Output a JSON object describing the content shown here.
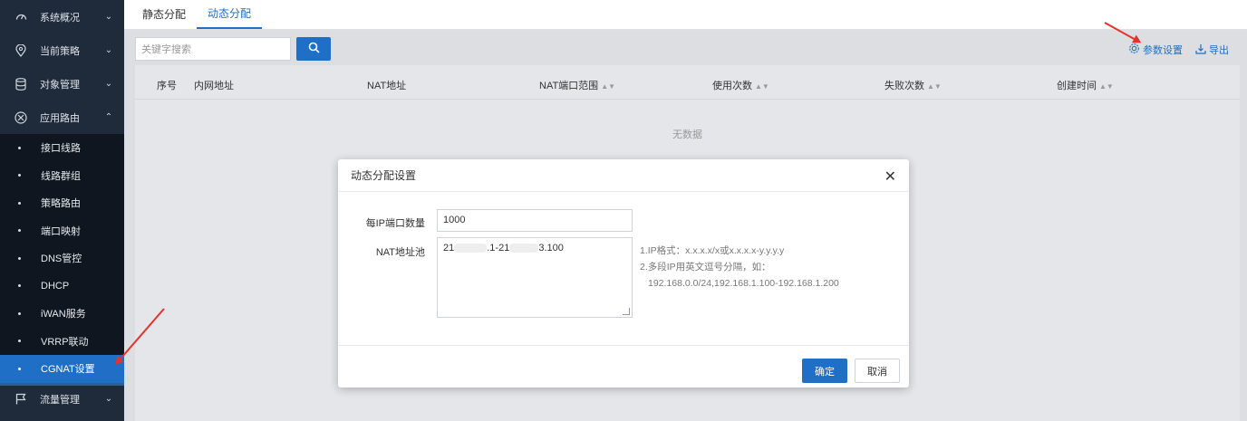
{
  "sidebar": {
    "groups_top": [
      {
        "label": "系统概况",
        "icon": "gauge-icon"
      },
      {
        "label": "当前策略",
        "icon": "location-pin-icon"
      },
      {
        "label": "对象管理",
        "icon": "database-icon"
      },
      {
        "label": "应用路由",
        "icon": "route-icon"
      }
    ],
    "sub_items": [
      {
        "label": "接口线路"
      },
      {
        "label": "线路群组"
      },
      {
        "label": "策略路由"
      },
      {
        "label": "端口映射"
      },
      {
        "label": "DNS管控"
      },
      {
        "label": "DHCP"
      },
      {
        "label": "iWAN服务"
      },
      {
        "label": "VRRP联动"
      },
      {
        "label": "CGNAT设置",
        "active": true
      }
    ],
    "groups_bottom": [
      {
        "label": "流量管理",
        "icon": "flag-icon"
      }
    ]
  },
  "tabs": [
    {
      "label": "静态分配"
    },
    {
      "label": "动态分配",
      "active": true
    }
  ],
  "toolbar": {
    "search_placeholder": "关键字搜索",
    "params_label": "参数设置",
    "export_label": "导出"
  },
  "table": {
    "columns": [
      "序号",
      "内网地址",
      "NAT地址",
      "NAT端口范围",
      "使用次数",
      "失败次数",
      "创建时间"
    ],
    "empty_text": "无数据"
  },
  "modal": {
    "title": "动态分配设置",
    "port_count_label": "每IP端口数量",
    "port_count_value": "1000",
    "pool_label": "NAT地址池",
    "pool_value_start": "21",
    "pool_value_mid": ".1-21",
    "pool_value_end": "3.100",
    "hint_line1": "1.IP格式：x.x.x.x/x或x.x.x.x-y.y.y.y",
    "hint_line2": "2.多段IP用英文逗号分隔，如：",
    "hint_line3": "192.168.0.0/24,192.168.1.100-192.168.1.200",
    "ok_label": "确定",
    "cancel_label": "取消"
  },
  "colors": {
    "accent": "#1e6fc5",
    "sidebar_bg": "#1f2a3a",
    "annotation_arrow": "#e8312b"
  }
}
